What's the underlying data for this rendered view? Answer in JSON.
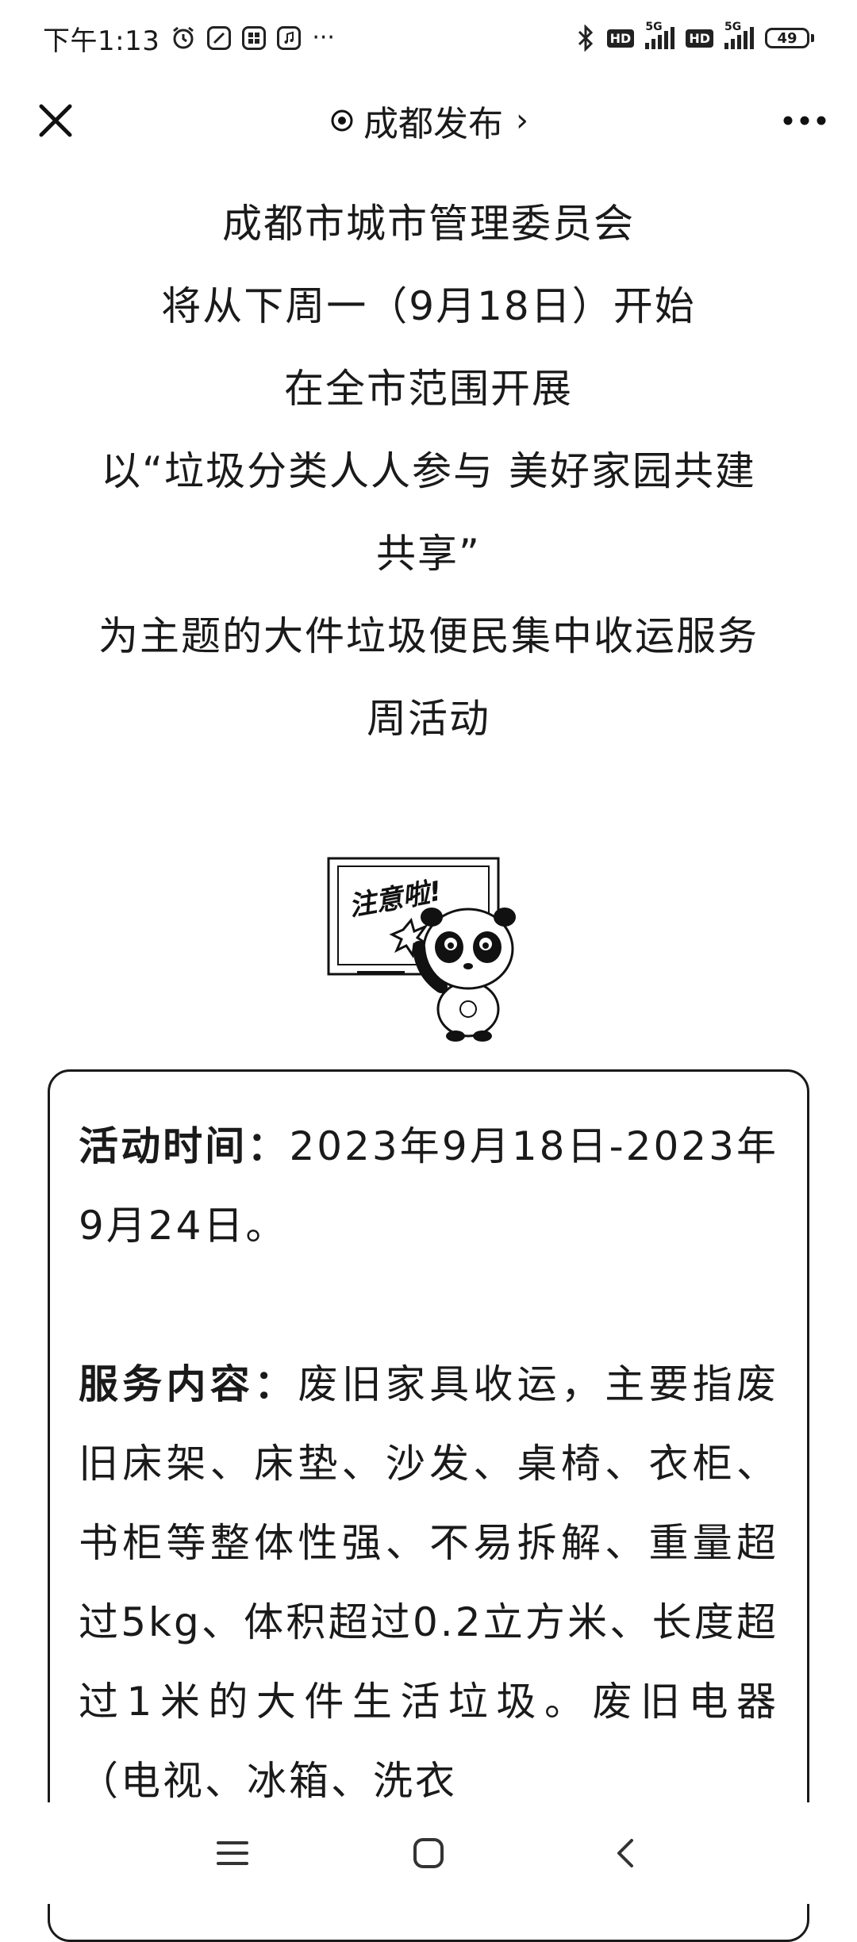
{
  "status_bar": {
    "time": "下午1:13",
    "more": "···",
    "network": "5G",
    "hd": "HD",
    "battery": "49"
  },
  "title_bar": {
    "account_name": "成都发布",
    "chevron": "›"
  },
  "article": {
    "intro_lines": [
      "成都市城市管理委员会",
      "将从下周一（9月18日）开始",
      "在全市范围开展",
      "以“垃圾分类人人参与 美好家园共建",
      "共享”",
      "为主题的大件垃圾便民集中收运服务",
      "周活动"
    ],
    "info": {
      "time_label": "活动时间：",
      "time_value": "2023年9月18日-2023年9月24日。",
      "service_label": "服务内容：",
      "service_value": "废旧家具收运，主要指废旧床架、床垫、沙发、桌椅、衣柜、书柜等整体性强、不易拆解、重量超过5kg、体积超过0.2立方米、长度超过1米的大件生活垃圾。废旧电器（电视、冰箱、洗衣"
    },
    "sticker_text": "注意啦!"
  },
  "icons": {
    "close": "close-icon",
    "more": "more-dots-icon",
    "target": "target-icon",
    "bluetooth": "bluetooth-icon",
    "alarm": "alarm-icon"
  }
}
